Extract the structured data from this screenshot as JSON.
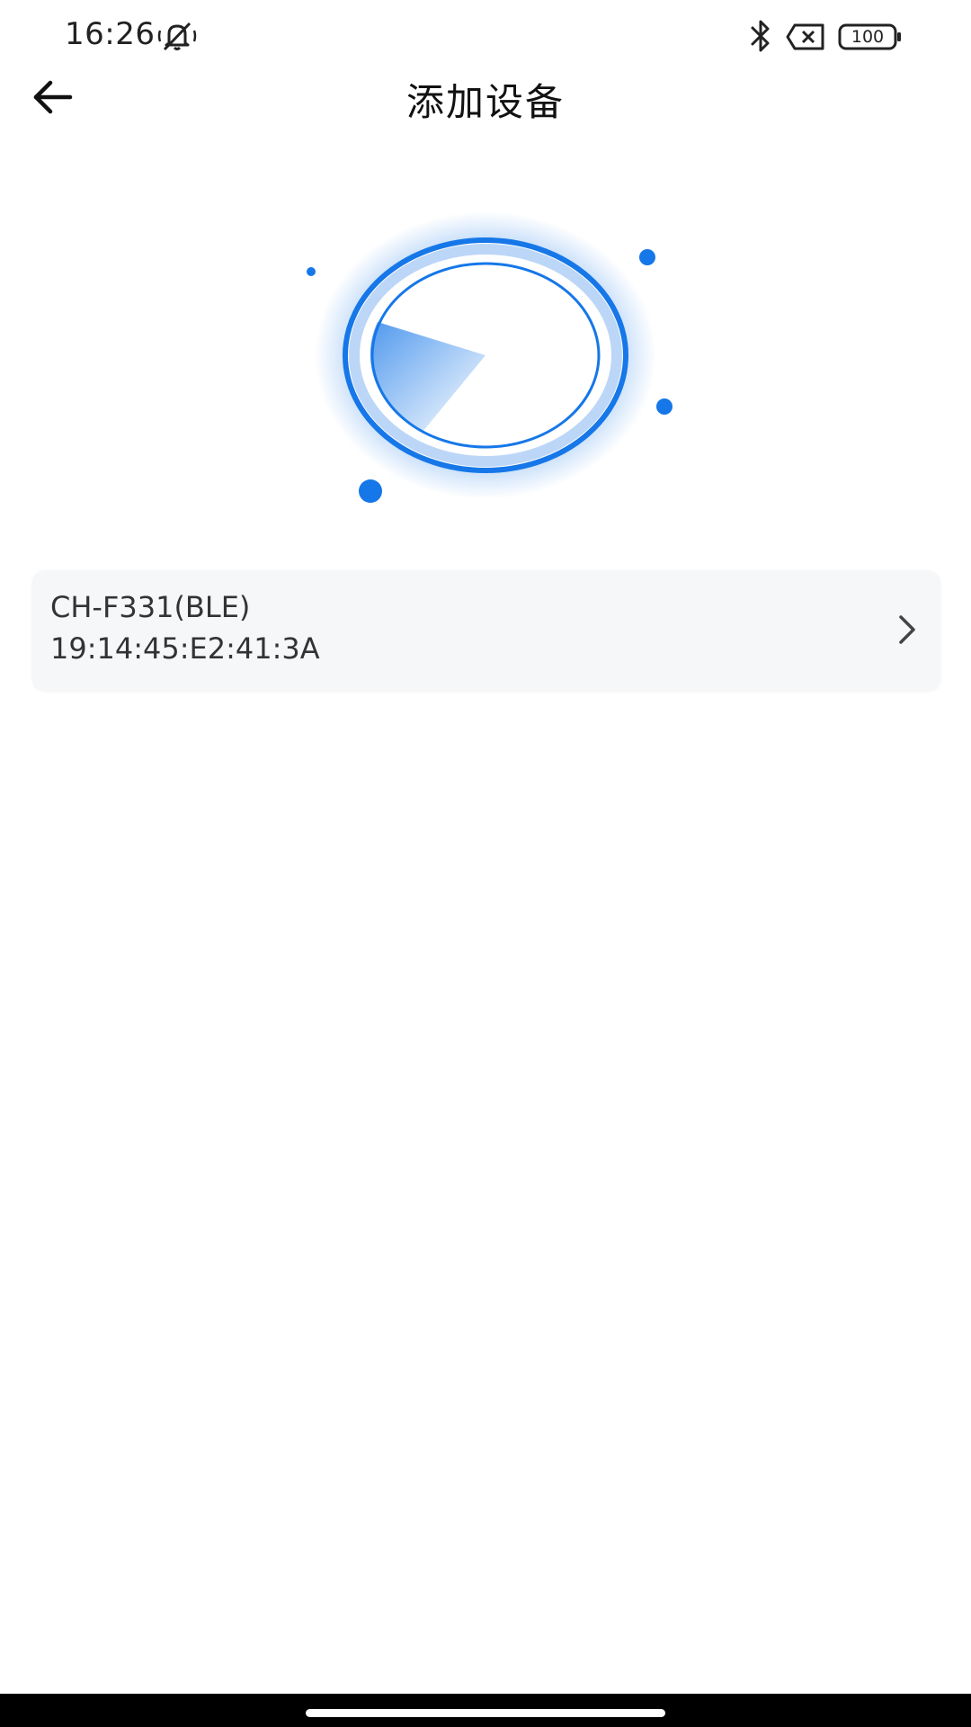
{
  "status_bar": {
    "time": "16:26",
    "battery_level": "100",
    "icons": [
      "mute-icon",
      "bluetooth-icon",
      "no-sim-icon",
      "battery-icon"
    ]
  },
  "header": {
    "title": "添加设备",
    "back_icon": "arrow-left-icon"
  },
  "scanner": {
    "icon": "bluetooth-scan-radar",
    "accent_color": "#1677e8"
  },
  "devices": [
    {
      "name": "CH-F331(BLE)",
      "address": "19:14:45:E2:41:3A",
      "action_icon": "chevron-right-icon"
    }
  ]
}
